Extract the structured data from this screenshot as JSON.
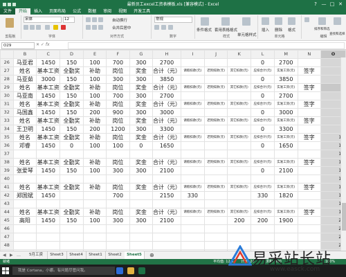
{
  "window": {
    "title": "最新员工excel工资表模板.xls [兼容模式] - Excel",
    "controls": [
      "?",
      "—",
      "□",
      "✕"
    ]
  },
  "menu": {
    "file": "文件",
    "tabs": [
      "开始",
      "插入",
      "页面布局",
      "公式",
      "数据",
      "审阅",
      "视图",
      "开发工具"
    ],
    "active": "开始"
  },
  "ribbon": {
    "font_name": "宋体",
    "font_size": "12",
    "wrap_text": "自动换行",
    "merge_center": "合并后居中",
    "number_format": "常规",
    "groups": [
      "剪贴板",
      "字体",
      "对齐方式",
      "数字",
      "样式",
      "单元格",
      "编辑"
    ],
    "buttons": {
      "conditional": "条件格式",
      "as_table": "套用表格格式",
      "cell_style": "单元格样式",
      "insert": "插入",
      "delete": "删除",
      "format": "格式",
      "sort_filter": "排序和筛选",
      "find_select": "查找和选择"
    }
  },
  "formula_bar": {
    "name_box": "O29",
    "fx": "fx",
    "value": ""
  },
  "grid": {
    "columns": [
      "B",
      "C",
      "D",
      "E",
      "F",
      "G",
      "H",
      "I",
      "J",
      "K",
      "L",
      "M",
      "N",
      "O"
    ],
    "rows": [
      {
        "n": "26",
        "cells": [
          "马亚君",
          "1450",
          "150",
          "100",
          "700",
          "300",
          "2700",
          "",
          "",
          "",
          "0",
          "2700",
          "",
          "1"
        ]
      },
      {
        "n": "27",
        "cells": [
          "姓名",
          "基本工资",
          "全勤奖",
          "补助",
          "岗位",
          "奖金",
          "合计（元）",
          "请假扣款(元)",
          "迟到扣款(元)",
          "其它扣款(元)",
          "应扣合计(元)",
          "实发工资(元)",
          "签字",
          "2"
        ]
      },
      {
        "n": "28",
        "cells": [
          "马亚茹",
          "3000",
          "150",
          "100",
          "300",
          "300",
          "3850",
          "",
          "",
          "",
          "0",
          "3850",
          "",
          "3"
        ]
      },
      {
        "n": "29",
        "cells": [
          "姓名",
          "基本工资",
          "全勤奖",
          "补助",
          "岗位",
          "奖金",
          "合计（元）",
          "请假扣款(元)",
          "迟到扣款(元)",
          "其它扣款(元)",
          "应扣合计(元)",
          "实发工资(元)",
          "签字",
          "4"
        ]
      },
      {
        "n": "30",
        "cells": [
          "马亚南",
          "1450",
          "150",
          "100",
          "700",
          "300",
          "2700",
          "",
          "",
          "",
          "0",
          "2700",
          "",
          "5"
        ]
      },
      {
        "n": "31",
        "cells": [
          "姓名",
          "基本工资",
          "全勤奖",
          "补助",
          "岗位",
          "奖金",
          "合计（元）",
          "请假扣款(元)",
          "迟到扣款(元)",
          "其它扣款(元)",
          "应扣合计(元)",
          "实发工资(元)",
          "签字",
          "6"
        ]
      },
      {
        "n": "32",
        "cells": [
          "马国鑫",
          "1450",
          "150",
          "200",
          "900",
          "300",
          "3000",
          "",
          "",
          "",
          "0",
          "3000",
          "",
          "7"
        ]
      },
      {
        "n": "33",
        "cells": [
          "姓名",
          "基本工资",
          "全勤奖",
          "补助",
          "岗位",
          "奖金",
          "合计（元）",
          "请假扣款(元)",
          "迟到扣款(元)",
          "其它扣款(元)",
          "应扣合计(元)",
          "实发工资(元)",
          "签字",
          "8"
        ]
      },
      {
        "n": "34",
        "cells": [
          "王卫明",
          "1450",
          "150",
          "200",
          "1200",
          "300",
          "3300",
          "",
          "",
          "",
          "0",
          "3300",
          "",
          "9"
        ]
      },
      {
        "n": "35",
        "cells": [
          "姓名",
          "基本工资",
          "全勤奖",
          "补助",
          "岗位",
          "奖金",
          "合计（元）",
          "请假扣款(元)",
          "迟到扣款(元)",
          "其它扣款(元)",
          "应扣合计(元)",
          "实发工资(元)",
          "签字",
          "10"
        ]
      },
      {
        "n": "36",
        "cells": [
          "邓睿",
          "1450",
          "0",
          "100",
          "100",
          "0",
          "1650",
          "",
          "",
          "",
          "0",
          "1650",
          "",
          "11"
        ]
      },
      {
        "n": "37",
        "cells": [
          "",
          "",
          "",
          "",
          "",
          "",
          "",
          "",
          "",
          "",
          "",
          "",
          "",
          "12"
        ]
      },
      {
        "n": "38",
        "cells": [
          "姓名",
          "基本工资",
          "全勤奖",
          "补助",
          "岗位",
          "奖金",
          "合计（元）",
          "请假扣款(元)",
          "迟到扣款(元)",
          "其它扣款(元)",
          "应扣合计(元)",
          "实发工资(元)",
          "签字",
          "13"
        ]
      },
      {
        "n": "39",
        "cells": [
          "张爱琴",
          "1450",
          "150",
          "100",
          "300",
          "300",
          "2100",
          "",
          "",
          "",
          "0",
          "2100",
          "",
          "14"
        ]
      },
      {
        "n": "40",
        "cells": [
          "",
          "",
          "",
          "",
          "",
          "",
          "",
          "",
          "",
          "",
          "",
          "",
          "",
          "15"
        ]
      },
      {
        "n": "41",
        "cells": [
          "姓名",
          "基本工资",
          "全勤奖",
          "补助",
          "岗位",
          "奖金",
          "合计（元）",
          "请假扣款(元)",
          "迟到扣款(元)",
          "其它扣款(元)",
          "应扣合计(元)",
          "实发工资(元)",
          "签字",
          "16"
        ]
      },
      {
        "n": "42",
        "cells": [
          "郑国斌",
          "1450",
          "",
          "",
          "700",
          "",
          "2150",
          "330",
          "",
          "",
          "330",
          "1820",
          "",
          "17"
        ]
      },
      {
        "n": "43",
        "cells": [
          "",
          "",
          "",
          "",
          "",
          "",
          "",
          "",
          "",
          "",
          "",
          "",
          "",
          "18"
        ]
      },
      {
        "n": "44",
        "cells": [
          "姓名",
          "基本工资",
          "全勤奖",
          "补助",
          "岗位",
          "奖金",
          "合计（元）",
          "请假扣款(元)",
          "迟到扣款(元)",
          "其它扣款(元)",
          "应扣合计(元)",
          "实发工资(元)",
          "签字",
          "19"
        ]
      },
      {
        "n": "45",
        "cells": [
          "高阳",
          "1450",
          "150",
          "100",
          "300",
          "300",
          "2100",
          "",
          "",
          "200",
          "200",
          "1900",
          "",
          "20"
        ]
      },
      {
        "n": "46",
        "cells": [
          "",
          "",
          "",
          "",
          "",
          "",
          "",
          "",
          "",
          "",
          "",
          "",
          "",
          "21"
        ]
      },
      {
        "n": "47",
        "cells": [
          "",
          "",
          "",
          "",
          "",
          "",
          "",
          "",
          "",
          "",
          "",
          "",
          "",
          "22"
        ]
      },
      {
        "n": "48",
        "cells": [
          "",
          "",
          "",
          "",
          "",
          "",
          "",
          "",
          "",
          "",
          "",
          "",
          "",
          "23"
        ]
      },
      {
        "n": "49",
        "cells": [
          "",
          "",
          "",
          "",
          "",
          "",
          "",
          "",
          "",
          "",
          "",
          "",
          "",
          ""
        ]
      }
    ]
  },
  "sheets": {
    "tabs": [
      "5月工资",
      "Sheet3",
      "Sheet4",
      "Sheet1",
      "Sheet2",
      "Sheet5"
    ],
    "active": "Sheet5",
    "add": "⊕"
  },
  "status": {
    "left": "就绪",
    "avg": "平均值: 12.5",
    "count": "计数: 24",
    "sum": "求和: 300",
    "zoom": "100%"
  },
  "taskbar": {
    "search": "我是 Cortana，小娜。有问题尽管问我。"
  },
  "watermark": {
    "text": "易采站长站",
    "url": "www.easck.com"
  },
  "colors": {
    "excel_green": "#1e7145",
    "selected_column": "#d6d6d6"
  }
}
